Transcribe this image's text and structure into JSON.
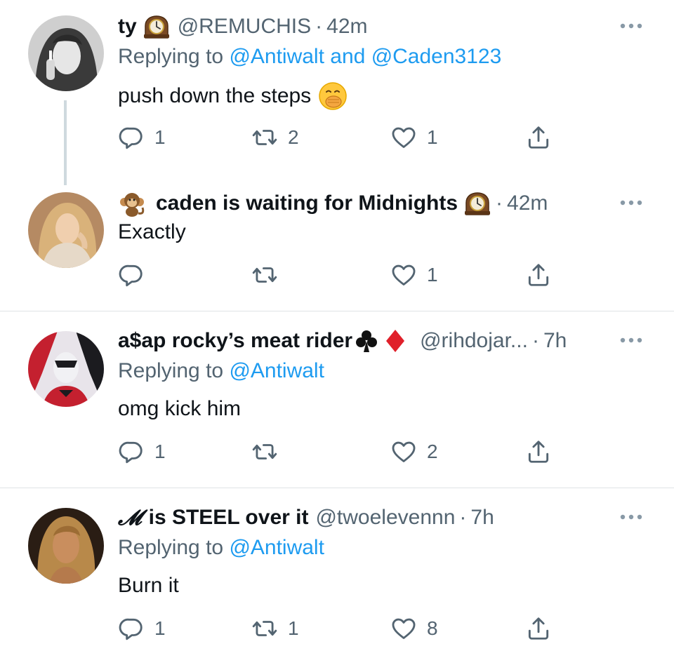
{
  "tweets": [
    {
      "name": "ty",
      "handle": "@REMUCHIS",
      "time": "42m",
      "reply_prefix": "Replying to",
      "mentions": [
        "@Antiwalt",
        "and",
        "@Caden3123"
      ],
      "text": "push down the steps",
      "counts": {
        "reply": "1",
        "retweet": "2",
        "like": "1"
      }
    },
    {
      "name": "caden is waiting for Midnights",
      "time": "42m",
      "text": "Exactly",
      "counts": {
        "reply": "",
        "retweet": "",
        "like": "1"
      }
    },
    {
      "name": "a$ap rocky’s meat rider",
      "handle": "@rihdojar...",
      "time": "7h",
      "reply_prefix": "Replying to",
      "mention": "@Antiwalt",
      "text": "omg kick him",
      "counts": {
        "reply": "1",
        "retweet": "",
        "like": "2"
      }
    },
    {
      "name_prefix": "𝓜",
      "name": "is STEEL over it",
      "handle": "@twoelevennn",
      "time": "7h",
      "reply_prefix": "Replying to",
      "mention": "@Antiwalt",
      "text": "Burn it",
      "counts": {
        "reply": "1",
        "retweet": "1",
        "like": "8"
      }
    }
  ],
  "separator": "·",
  "icons": {
    "reply": "reply-icon",
    "retweet": "retweet-icon",
    "like": "like-icon",
    "share": "share-icon",
    "more": "more-options-icon"
  },
  "colors": {
    "text": "#0f1419",
    "secondary": "#536471",
    "link": "#1d9bf0",
    "divider": "#dfe3e6"
  }
}
